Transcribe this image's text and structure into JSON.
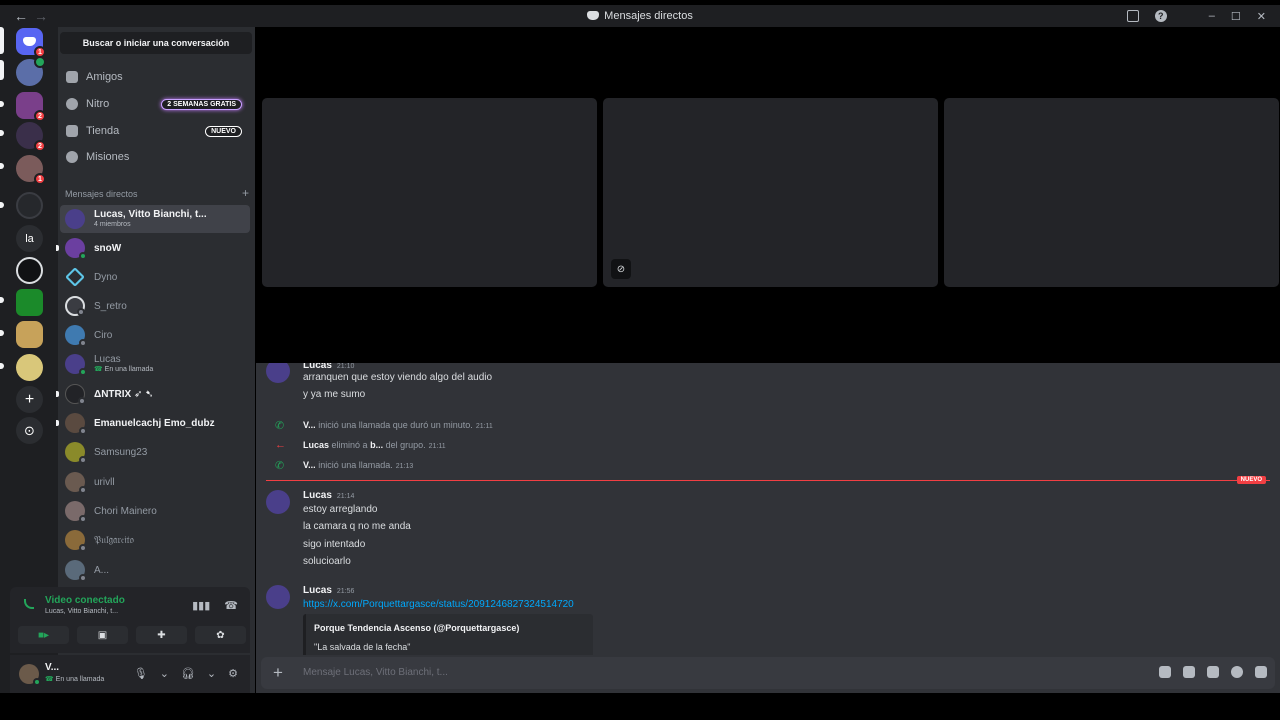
{
  "window": {
    "back": "←",
    "forward": "→",
    "title": "Mensajes directos",
    "minimize": "–",
    "maximize": "☐",
    "close": "✕"
  },
  "servers": [
    {
      "label": "",
      "badge": "1",
      "color": "#5865f2"
    },
    {
      "label": "",
      "badge": "",
      "color": "#5b6ea8"
    },
    {
      "label": "",
      "badge": "2",
      "color": "#7a3f8a"
    },
    {
      "label": "",
      "badge": "2",
      "color": "#3a2f4a"
    },
    {
      "label": "",
      "badge": "1",
      "color": "#7b5b5b"
    },
    {
      "label": "",
      "badge": "",
      "color": "#26282c"
    },
    {
      "label": "la",
      "badge": "",
      "color": "#2b2d31"
    },
    {
      "label": "",
      "badge": "",
      "color": "#111214"
    },
    {
      "label": "",
      "badge": "",
      "color": "#1b8a2a"
    },
    {
      "label": "",
      "badge": "",
      "color": "#c7a25a"
    },
    {
      "label": "",
      "badge": "",
      "color": "#d9c77a"
    }
  ],
  "add_server": "+",
  "discover": "⊙",
  "search": {
    "label": "Buscar o iniciar una conversación"
  },
  "nav": {
    "friends": "Amigos",
    "nitro": "Nitro",
    "nitro_tag": "2 SEMANAS GRATIS",
    "shop": "Tienda",
    "shop_tag": "NUEVO",
    "quests": "Misiones"
  },
  "dm_header": {
    "label": "Mensajes directos",
    "add": "+"
  },
  "dms": [
    {
      "name": "Lucas, Vitto Bianchi, t...",
      "sub": "4 miembros",
      "color": "#4a3f8a"
    },
    {
      "name": "snoW",
      "sub": "",
      "color": "#6b3fa0"
    },
    {
      "name": "Dyno",
      "sub": "",
      "color": "#2b2d31"
    },
    {
      "name": "S_retro",
      "sub": "",
      "color": "#3a3c42"
    },
    {
      "name": "Ciro",
      "sub": "",
      "color": "#3f7ab0"
    },
    {
      "name": "Lucas",
      "sub": "En una llamada",
      "color": "#4a3f8a"
    },
    {
      "name": "ΔNTRIX ➶ ➷",
      "sub": "",
      "color": "#222327"
    },
    {
      "name": "Emanuelcachj Emo_dubz",
      "sub": "",
      "color": "#5a4a40"
    },
    {
      "name": "Samsung23",
      "sub": "",
      "color": "#8a8a2a"
    },
    {
      "name": "urivll",
      "sub": "",
      "color": "#6a5a50"
    },
    {
      "name": "Chori Mainero",
      "sub": "",
      "color": "#7a6a6a"
    },
    {
      "name": "𝔓𝔲𝔩𝔤𝔞𝔯𝔠𝔦𝔱𝔬",
      "sub": "",
      "color": "#8a6a3a"
    },
    {
      "name": "A...",
      "sub": "",
      "color": "#5a6a7a"
    }
  ],
  "voice": {
    "status": "Video conectado",
    "channel": "Lucas, Vitto Bianchi, t..."
  },
  "user": {
    "name": "V...",
    "status": "En una llamada"
  },
  "chat": {
    "m1_author": "Lucas",
    "m1_time": "21:10",
    "m1_l1": "arranquen que estoy viendo algo del audio",
    "m1_l2": "y ya me sumo",
    "s1_user": "V...",
    "s1_text": "inició una llamada que duró un minuto.",
    "s1_time": "21:11",
    "s2_user": "Lucas",
    "s2_mid": "eliminó a",
    "s2_target": "b...",
    "s2_text": "del grupo.",
    "s2_time": "21:11",
    "s3_user": "V...",
    "s3_text": "inició una llamada.",
    "s3_time": "21:13",
    "new_tag": "NUEVO",
    "m2_author": "Lucas",
    "m2_time": "21:14",
    "m2_l1": "estoy arreglando",
    "m2_l2": "la camara q no me anda",
    "m2_l3": "sigo intentado",
    "m2_l4": "solucioarlo",
    "m3_author": "Lucas",
    "m3_time": "21:56",
    "m3_link": "https://x.com/Porquettargasce/status/2091246827324514720",
    "embed_title": "Porque Tendencia Ascenso (@Porquettargasce)",
    "embed_desc": "\"La salvada de la fecha\""
  },
  "composer": {
    "placeholder": "Mensaje Lucas, Vitto Bianchi, t..."
  }
}
